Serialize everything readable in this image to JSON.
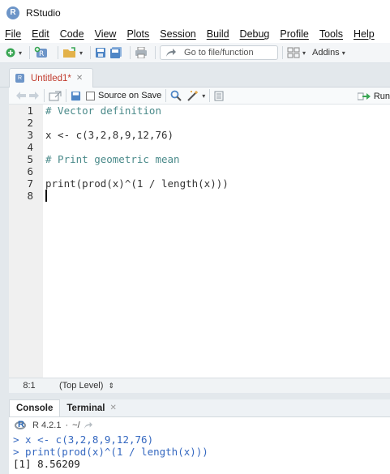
{
  "window": {
    "title": "RStudio",
    "logo_letter": "R"
  },
  "menu": [
    "File",
    "Edit",
    "Code",
    "View",
    "Plots",
    "Session",
    "Build",
    "Debug",
    "Profile",
    "Tools",
    "Help"
  ],
  "toolbar": {
    "goto_placeholder": "Go to file/function",
    "addins_label": "Addins"
  },
  "editor": {
    "tab": {
      "name": "Untitled1*",
      "modified": true
    },
    "source_on_save_label": "Source on Save",
    "run_label": "Run",
    "lines": [
      {
        "num": "1",
        "text": "# Vector definition",
        "kind": "comment"
      },
      {
        "num": "2",
        "text": "",
        "kind": "plain"
      },
      {
        "num": "3",
        "text": "x <- c(3,2,8,9,12,76)",
        "kind": "plain"
      },
      {
        "num": "4",
        "text": "",
        "kind": "plain"
      },
      {
        "num": "5",
        "text": "# Print geometric mean",
        "kind": "comment"
      },
      {
        "num": "6",
        "text": "",
        "kind": "plain"
      },
      {
        "num": "7",
        "text": "print(prod(x)^(1 / length(x)))",
        "kind": "plain"
      },
      {
        "num": "8",
        "text": "",
        "kind": "plain"
      }
    ],
    "status": {
      "position": "8:1",
      "scope": "(Top Level)"
    }
  },
  "console": {
    "tabs": [
      {
        "label": "Console",
        "active": true
      },
      {
        "label": "Terminal",
        "active": false
      }
    ],
    "version": "R 4.2.1",
    "working_dir": "~/",
    "lines": [
      {
        "text": "> x <- c(3,2,8,9,12,76)",
        "kind": "cmd"
      },
      {
        "text": "> print(prod(x)^(1 / length(x)))",
        "kind": "cmd"
      },
      {
        "text": "[1] 8.56209",
        "kind": "out"
      }
    ]
  },
  "colors": {
    "comment": "#4a8a8a",
    "console_command": "#3568c0",
    "modified_tab": "#c0392b"
  }
}
